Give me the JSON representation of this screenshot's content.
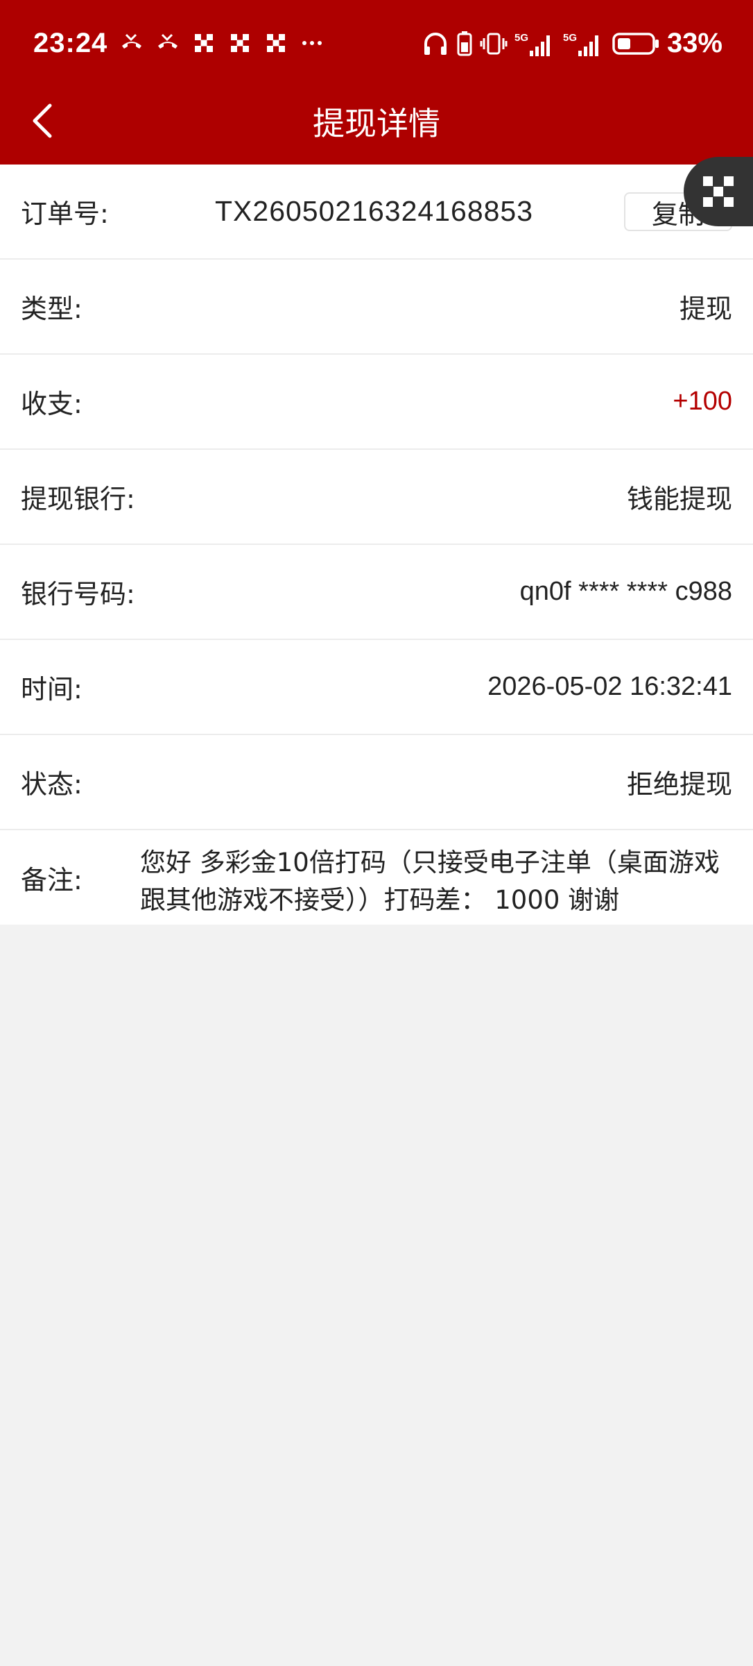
{
  "status_bar": {
    "time": "23:24",
    "battery_percent": "33%",
    "network_1": "5G",
    "network_2": "5G"
  },
  "header": {
    "title": "提现详情"
  },
  "order": {
    "label": "订单号:",
    "value": "TX26050216324168853",
    "copy_label": "复制"
  },
  "rows": [
    {
      "label": "类型:",
      "value": "提现"
    },
    {
      "label": "收支:",
      "value": "+100"
    },
    {
      "label": "提现银行:",
      "value": "钱能提现"
    },
    {
      "label": "银行号码:",
      "value": "qn0f **** **** c988"
    },
    {
      "label": "时间:",
      "value": "2026-05-02 16:32:41"
    },
    {
      "label": "状态:",
      "value": "拒绝提现"
    }
  ],
  "remark": {
    "label": "备注:",
    "value": "您好 多彩金10倍打码（只接受电子注单（桌面游戏跟其他游戏不接受））打码差： 1000 谢谢"
  },
  "colors": {
    "header_bg": "#ae0000",
    "amount_color": "#b40000",
    "page_bg": "#f2f2f2"
  },
  "icons": {
    "back": "chevron-left-icon",
    "float": "qr-code-icon"
  }
}
